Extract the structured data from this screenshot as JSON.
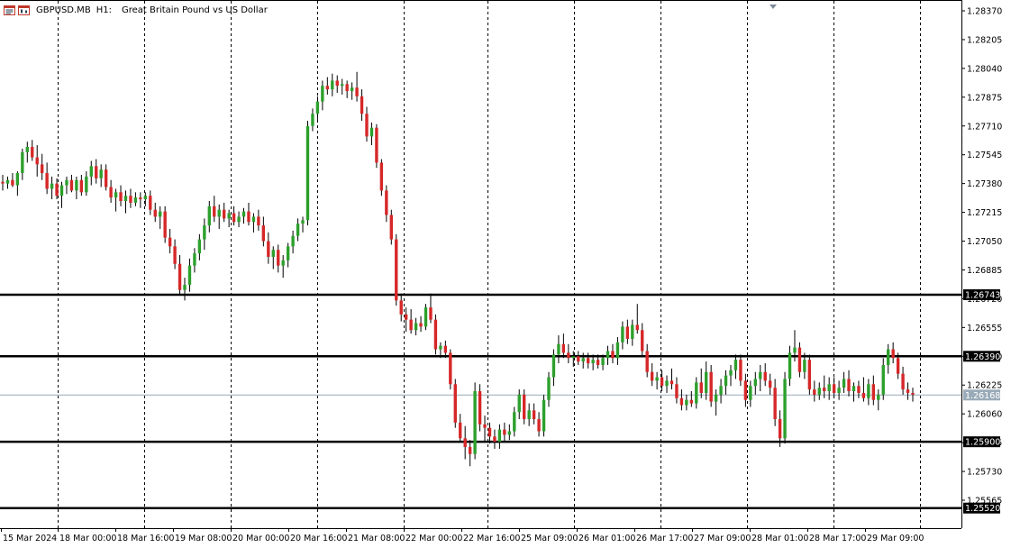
{
  "header": {
    "symbol": "GBPUSD.MB",
    "timeframe": "H1:",
    "description": "Great Britain Pound vs US Dollar",
    "icons": [
      "chart-window-icon",
      "candlestick-chart-icon"
    ]
  },
  "colors": {
    "background": "#ffffff",
    "bull_candle": "#2ca02c",
    "bear_candle": "#d62728",
    "wick": "#000000",
    "grid": "#000000",
    "current_price_line": "#9aaab8",
    "level_label_bg": "#000000",
    "level_label_fg": "#ffffff",
    "current_label_bg": "#9aaab8"
  },
  "chart_data": {
    "type": "candlestick",
    "symbol": "GBPUSD.MB",
    "timeframe": "H1",
    "ylim": [
      1.2551,
      1.2839
    ],
    "y_ticks": [
      "1.28370",
      "1.28205",
      "1.28040",
      "1.27875",
      "1.27710",
      "1.27545",
      "1.27380",
      "1.27215",
      "1.27050",
      "1.26885",
      "1.26720",
      "1.26555",
      "1.26390",
      "1.26225",
      "1.26060",
      "1.25895",
      "1.25730",
      "1.25565"
    ],
    "x_ticks": [
      "15 Mar 2024",
      "18 Mar 00:00",
      "18 Mar 16:00",
      "19 Mar 08:00",
      "20 Mar 00:00",
      "20 Mar 16:00",
      "21 Mar 08:00",
      "22 Mar 00:00",
      "22 Mar 16:00",
      "25 Mar 09:00",
      "26 Mar 01:00",
      "26 Mar 17:00",
      "27 Mar 09:00",
      "28 Mar 01:00",
      "28 Mar 17:00",
      "29 Mar 09:00"
    ],
    "horizontal_levels": [
      "1.26743",
      "1.26390",
      "1.25900",
      "1.25520"
    ],
    "current_price": "1.26168",
    "grid": "vertical dashed",
    "candles": [
      [
        1.2739,
        1.2743,
        1.2734,
        1.2738
      ],
      [
        1.2738,
        1.2742,
        1.2735,
        1.274
      ],
      [
        1.274,
        1.2744,
        1.2736,
        1.2737
      ],
      [
        1.2737,
        1.2745,
        1.2731,
        1.2744
      ],
      [
        1.2744,
        1.2758,
        1.274,
        1.2756
      ],
      [
        1.2756,
        1.2762,
        1.275,
        1.2759
      ],
      [
        1.2759,
        1.2763,
        1.2751,
        1.2753
      ],
      [
        1.2753,
        1.276,
        1.2742,
        1.2749
      ],
      [
        1.2749,
        1.2755,
        1.274,
        1.2744
      ],
      [
        1.2744,
        1.275,
        1.2732,
        1.2735
      ],
      [
        1.2735,
        1.2742,
        1.2729,
        1.2738
      ],
      [
        1.2738,
        1.2741,
        1.2729,
        1.2731
      ],
      [
        1.2731,
        1.2739,
        1.2724,
        1.2737
      ],
      [
        1.2737,
        1.2742,
        1.2732,
        1.274
      ],
      [
        1.274,
        1.2743,
        1.2733,
        1.2734
      ],
      [
        1.2734,
        1.2742,
        1.2729,
        1.274
      ],
      [
        1.274,
        1.2743,
        1.2731,
        1.2733
      ],
      [
        1.2733,
        1.2745,
        1.2731,
        1.2742
      ],
      [
        1.2742,
        1.2751,
        1.2737,
        1.2748
      ],
      [
        1.2748,
        1.2752,
        1.2738,
        1.2741
      ],
      [
        1.2741,
        1.2749,
        1.2736,
        1.2746
      ],
      [
        1.2746,
        1.2749,
        1.2734,
        1.2736
      ],
      [
        1.2736,
        1.274,
        1.2727,
        1.273
      ],
      [
        1.273,
        1.2735,
        1.2722,
        1.2733
      ],
      [
        1.2733,
        1.2737,
        1.2725,
        1.2728
      ],
      [
        1.2728,
        1.2734,
        1.2721,
        1.2731
      ],
      [
        1.2731,
        1.2735,
        1.2724,
        1.2727
      ],
      [
        1.2727,
        1.2733,
        1.2725,
        1.273
      ],
      [
        1.273,
        1.2733,
        1.2724,
        1.2729
      ],
      [
        1.2729,
        1.2733,
        1.2725,
        1.2731
      ],
      [
        1.2731,
        1.2734,
        1.272,
        1.2723
      ],
      [
        1.2723,
        1.2727,
        1.2716,
        1.2719
      ],
      [
        1.2719,
        1.2725,
        1.2712,
        1.2722
      ],
      [
        1.2722,
        1.2725,
        1.2704,
        1.2707
      ],
      [
        1.2707,
        1.2712,
        1.2698,
        1.2702
      ],
      [
        1.2702,
        1.2706,
        1.2689,
        1.2692
      ],
      [
        1.2692,
        1.2697,
        1.2674,
        1.2677
      ],
      [
        1.2677,
        1.2684,
        1.2671,
        1.268
      ],
      [
        1.268,
        1.2695,
        1.2676,
        1.2691
      ],
      [
        1.2691,
        1.2701,
        1.2687,
        1.2698
      ],
      [
        1.2698,
        1.2709,
        1.2694,
        1.2706
      ],
      [
        1.2706,
        1.2718,
        1.27,
        1.2714
      ],
      [
        1.2714,
        1.2728,
        1.271,
        1.2725
      ],
      [
        1.2725,
        1.2731,
        1.2716,
        1.2719
      ],
      [
        1.2719,
        1.2726,
        1.2712,
        1.2723
      ],
      [
        1.2723,
        1.2727,
        1.2716,
        1.2718
      ],
      [
        1.2718,
        1.2723,
        1.2713,
        1.2721
      ],
      [
        1.2721,
        1.2725,
        1.2714,
        1.2716
      ],
      [
        1.2716,
        1.2722,
        1.2713,
        1.2719
      ],
      [
        1.2719,
        1.2724,
        1.2715,
        1.2722
      ],
      [
        1.2722,
        1.2727,
        1.2714,
        1.2716
      ],
      [
        1.2716,
        1.2721,
        1.271,
        1.2719
      ],
      [
        1.2719,
        1.2723,
        1.2711,
        1.2714
      ],
      [
        1.2714,
        1.2719,
        1.2702,
        1.2705
      ],
      [
        1.2705,
        1.271,
        1.2692,
        1.2696
      ],
      [
        1.2696,
        1.2702,
        1.2689,
        1.27
      ],
      [
        1.27,
        1.2703,
        1.2687,
        1.2691
      ],
      [
        1.2691,
        1.2697,
        1.2684,
        1.2694
      ],
      [
        1.2694,
        1.2704,
        1.269,
        1.2702
      ],
      [
        1.2702,
        1.2711,
        1.2698,
        1.2708
      ],
      [
        1.2708,
        1.2718,
        1.2705,
        1.2715
      ],
      [
        1.2715,
        1.2719,
        1.271,
        1.2717
      ],
      [
        1.2717,
        1.2774,
        1.2714,
        1.2771
      ],
      [
        1.2771,
        1.2781,
        1.2768,
        1.2778
      ],
      [
        1.2778,
        1.2788,
        1.2774,
        1.2785
      ],
      [
        1.2785,
        1.2797,
        1.278,
        1.2794
      ],
      [
        1.2794,
        1.2799,
        1.2789,
        1.2792
      ],
      [
        1.2792,
        1.2801,
        1.2788,
        1.2797
      ],
      [
        1.2797,
        1.28,
        1.279,
        1.2794
      ],
      [
        1.2794,
        1.2798,
        1.2789,
        1.2795
      ],
      [
        1.2795,
        1.2797,
        1.2787,
        1.2791
      ],
      [
        1.2791,
        1.2796,
        1.2786,
        1.2793
      ],
      [
        1.2793,
        1.2802,
        1.2785,
        1.2788
      ],
      [
        1.2788,
        1.2792,
        1.2774,
        1.2778
      ],
      [
        1.2778,
        1.2782,
        1.2762,
        1.2765
      ],
      [
        1.2765,
        1.2773,
        1.276,
        1.277
      ],
      [
        1.277,
        1.2772,
        1.2747,
        1.275
      ],
      [
        1.275,
        1.2752,
        1.2731,
        1.2734
      ],
      [
        1.2734,
        1.2737,
        1.2716,
        1.272
      ],
      [
        1.272,
        1.2723,
        1.2703,
        1.2706
      ],
      [
        1.2706,
        1.2709,
        1.2668,
        1.2671
      ],
      [
        1.2671,
        1.2675,
        1.2659,
        1.2663
      ],
      [
        1.2663,
        1.2667,
        1.2653,
        1.266
      ],
      [
        1.266,
        1.2666,
        1.2652,
        1.2654
      ],
      [
        1.2654,
        1.2661,
        1.2651,
        1.2658
      ],
      [
        1.2658,
        1.2662,
        1.2653,
        1.2656
      ],
      [
        1.2656,
        1.2669,
        1.2654,
        1.2667
      ],
      [
        1.2667,
        1.2675,
        1.2658,
        1.266
      ],
      [
        1.266,
        1.2663,
        1.264,
        1.2643
      ],
      [
        1.2643,
        1.2647,
        1.2638,
        1.2645
      ],
      [
        1.2645,
        1.2648,
        1.2638,
        1.2641
      ],
      [
        1.2641,
        1.2643,
        1.262,
        1.2623
      ],
      [
        1.2623,
        1.2626,
        1.2598,
        1.2601
      ],
      [
        1.2601,
        1.2606,
        1.259,
        1.2592
      ],
      [
        1.2592,
        1.2599,
        1.258,
        1.2587
      ],
      [
        1.2587,
        1.2591,
        1.2576,
        1.2583
      ],
      [
        1.2583,
        1.2624,
        1.258,
        1.2619
      ],
      [
        1.2619,
        1.2623,
        1.2596,
        1.26
      ],
      [
        1.26,
        1.2605,
        1.259,
        1.2598
      ],
      [
        1.2598,
        1.2601,
        1.2589,
        1.2593
      ],
      [
        1.2593,
        1.2597,
        1.2586,
        1.259
      ],
      [
        1.259,
        1.26,
        1.2586,
        1.2597
      ],
      [
        1.2597,
        1.2601,
        1.259,
        1.2594
      ],
      [
        1.2594,
        1.26,
        1.2591,
        1.2596
      ],
      [
        1.2596,
        1.261,
        1.2593,
        1.2607
      ],
      [
        1.2607,
        1.262,
        1.2603,
        1.2617
      ],
      [
        1.2617,
        1.262,
        1.26,
        1.2603
      ],
      [
        1.2603,
        1.2612,
        1.2599,
        1.2608
      ],
      [
        1.2608,
        1.2612,
        1.26,
        1.2603
      ],
      [
        1.2603,
        1.2607,
        1.2593,
        1.2596
      ],
      [
        1.2596,
        1.2617,
        1.2593,
        1.2614
      ],
      [
        1.2614,
        1.263,
        1.261,
        1.2627
      ],
      [
        1.2627,
        1.2643,
        1.2622,
        1.264
      ],
      [
        1.264,
        1.2651,
        1.2635,
        1.2646
      ],
      [
        1.2646,
        1.2652,
        1.2638,
        1.2641
      ],
      [
        1.2641,
        1.2646,
        1.2635,
        1.2638
      ],
      [
        1.2638,
        1.2642,
        1.2633,
        1.2639
      ],
      [
        1.2639,
        1.2642,
        1.2634,
        1.2636
      ],
      [
        1.2636,
        1.2641,
        1.2632,
        1.2638
      ],
      [
        1.2638,
        1.2641,
        1.2632,
        1.2635
      ],
      [
        1.2635,
        1.264,
        1.2631,
        1.2637
      ],
      [
        1.2637,
        1.264,
        1.2632,
        1.2634
      ],
      [
        1.2634,
        1.264,
        1.2631,
        1.2638
      ],
      [
        1.2638,
        1.2645,
        1.2634,
        1.2642
      ],
      [
        1.2642,
        1.2646,
        1.2635,
        1.2638
      ],
      [
        1.2638,
        1.265,
        1.2634,
        1.2647
      ],
      [
        1.2647,
        1.2659,
        1.2643,
        1.2656
      ],
      [
        1.2656,
        1.266,
        1.2646,
        1.2649
      ],
      [
        1.2649,
        1.266,
        1.2645,
        1.2657
      ],
      [
        1.2657,
        1.2669,
        1.2652,
        1.2654
      ],
      [
        1.2654,
        1.2658,
        1.2639,
        1.2642
      ],
      [
        1.2642,
        1.2646,
        1.2627,
        1.263
      ],
      [
        1.263,
        1.2635,
        1.2622,
        1.2625
      ],
      [
        1.2625,
        1.263,
        1.262,
        1.2627
      ],
      [
        1.2627,
        1.2631,
        1.2619,
        1.2622
      ],
      [
        1.2622,
        1.2628,
        1.2618,
        1.2625
      ],
      [
        1.2625,
        1.2632,
        1.262,
        1.2623
      ],
      [
        1.2623,
        1.2627,
        1.2612,
        1.2615
      ],
      [
        1.2615,
        1.262,
        1.2608,
        1.2611
      ],
      [
        1.2611,
        1.2617,
        1.2608,
        1.2614
      ],
      [
        1.2614,
        1.2619,
        1.261,
        1.2612
      ],
      [
        1.2612,
        1.2627,
        1.2609,
        1.2624
      ],
      [
        1.2624,
        1.2632,
        1.2615,
        1.2618
      ],
      [
        1.2618,
        1.2636,
        1.2614,
        1.263
      ],
      [
        1.263,
        1.2634,
        1.261,
        1.2613
      ],
      [
        1.2613,
        1.262,
        1.2605,
        1.2617
      ],
      [
        1.2617,
        1.2626,
        1.2612,
        1.2622
      ],
      [
        1.2622,
        1.2631,
        1.2617,
        1.2628
      ],
      [
        1.2628,
        1.2634,
        1.2622,
        1.2631
      ],
      [
        1.2631,
        1.264,
        1.2626,
        1.2637
      ],
      [
        1.2637,
        1.264,
        1.2622,
        1.2625
      ],
      [
        1.2625,
        1.2629,
        1.261,
        1.2614
      ],
      [
        1.2614,
        1.2625,
        1.261,
        1.2622
      ],
      [
        1.2622,
        1.263,
        1.2617,
        1.2626
      ],
      [
        1.2626,
        1.2634,
        1.2619,
        1.263
      ],
      [
        1.263,
        1.2635,
        1.2622,
        1.2625
      ],
      [
        1.2625,
        1.2629,
        1.2617,
        1.2621
      ],
      [
        1.2621,
        1.2626,
        1.2599,
        1.2603
      ],
      [
        1.2603,
        1.2608,
        1.2587,
        1.2592
      ],
      [
        1.2592,
        1.263,
        1.2589,
        1.2626
      ],
      [
        1.2626,
        1.2645,
        1.2622,
        1.2641
      ],
      [
        1.2641,
        1.2654,
        1.2636,
        1.2644
      ],
      [
        1.2644,
        1.2647,
        1.2627,
        1.263
      ],
      [
        1.263,
        1.2641,
        1.2626,
        1.2637
      ],
      [
        1.2637,
        1.264,
        1.2617,
        1.262
      ],
      [
        1.262,
        1.2625,
        1.2613,
        1.2617
      ],
      [
        1.2617,
        1.2624,
        1.2614,
        1.2621
      ],
      [
        1.2621,
        1.2628,
        1.2615,
        1.2619
      ],
      [
        1.2619,
        1.2627,
        1.2614,
        1.2623
      ],
      [
        1.2623,
        1.2627,
        1.2615,
        1.2618
      ],
      [
        1.2618,
        1.2625,
        1.2614,
        1.2621
      ],
      [
        1.2621,
        1.263,
        1.2618,
        1.2626
      ],
      [
        1.2626,
        1.2631,
        1.2616,
        1.2619
      ],
      [
        1.2619,
        1.2624,
        1.2613,
        1.2622
      ],
      [
        1.2622,
        1.2625,
        1.2615,
        1.2618
      ],
      [
        1.2618,
        1.2627,
        1.2613,
        1.2615
      ],
      [
        1.2615,
        1.2626,
        1.2611,
        1.2623
      ],
      [
        1.2623,
        1.2628,
        1.2611,
        1.2614
      ],
      [
        1.2614,
        1.262,
        1.2608,
        1.2617
      ],
      [
        1.2617,
        1.2638,
        1.2614,
        1.2634
      ],
      [
        1.2634,
        1.2646,
        1.2629,
        1.2643
      ],
      [
        1.2643,
        1.2647,
        1.2635,
        1.2638
      ],
      [
        1.2638,
        1.2641,
        1.2626,
        1.2629
      ],
      [
        1.2629,
        1.2633,
        1.2617,
        1.262
      ],
      [
        1.262,
        1.2624,
        1.2614,
        1.2618
      ],
      [
        1.2618,
        1.2621,
        1.2613,
        1.2617
      ]
    ]
  }
}
